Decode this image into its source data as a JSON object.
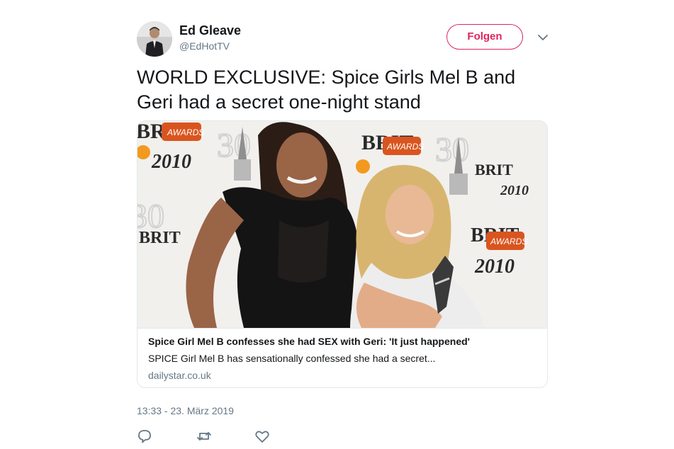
{
  "author": {
    "name": "Ed Gleave",
    "handle": "@EdHotTV"
  },
  "follow_button": {
    "label": "Folgen"
  },
  "tweet": {
    "text": "WORLD EXCLUSIVE: Spice Girls Mel B and Geri had a secret one-night stand",
    "timestamp": "13:33 - 23. März 2019"
  },
  "card": {
    "title": "Spice Girl Mel B confesses she had SEX with Geri: 'It just happened'",
    "description": "SPICE Girl Mel B has sensationally confessed she had a secret...",
    "domain": "dailystar.co.uk",
    "backdrop": {
      "brand": "BRIT",
      "year": "2010",
      "badge": "AWARDS",
      "number": "30"
    }
  },
  "colors": {
    "accent": "#e0245e",
    "text": "#14171a",
    "secondary": "#657786",
    "border": "#e1e8ed"
  },
  "icons": {
    "caret": "chevron-down-icon",
    "reply": "reply-icon",
    "retweet": "retweet-icon",
    "like": "heart-icon"
  }
}
